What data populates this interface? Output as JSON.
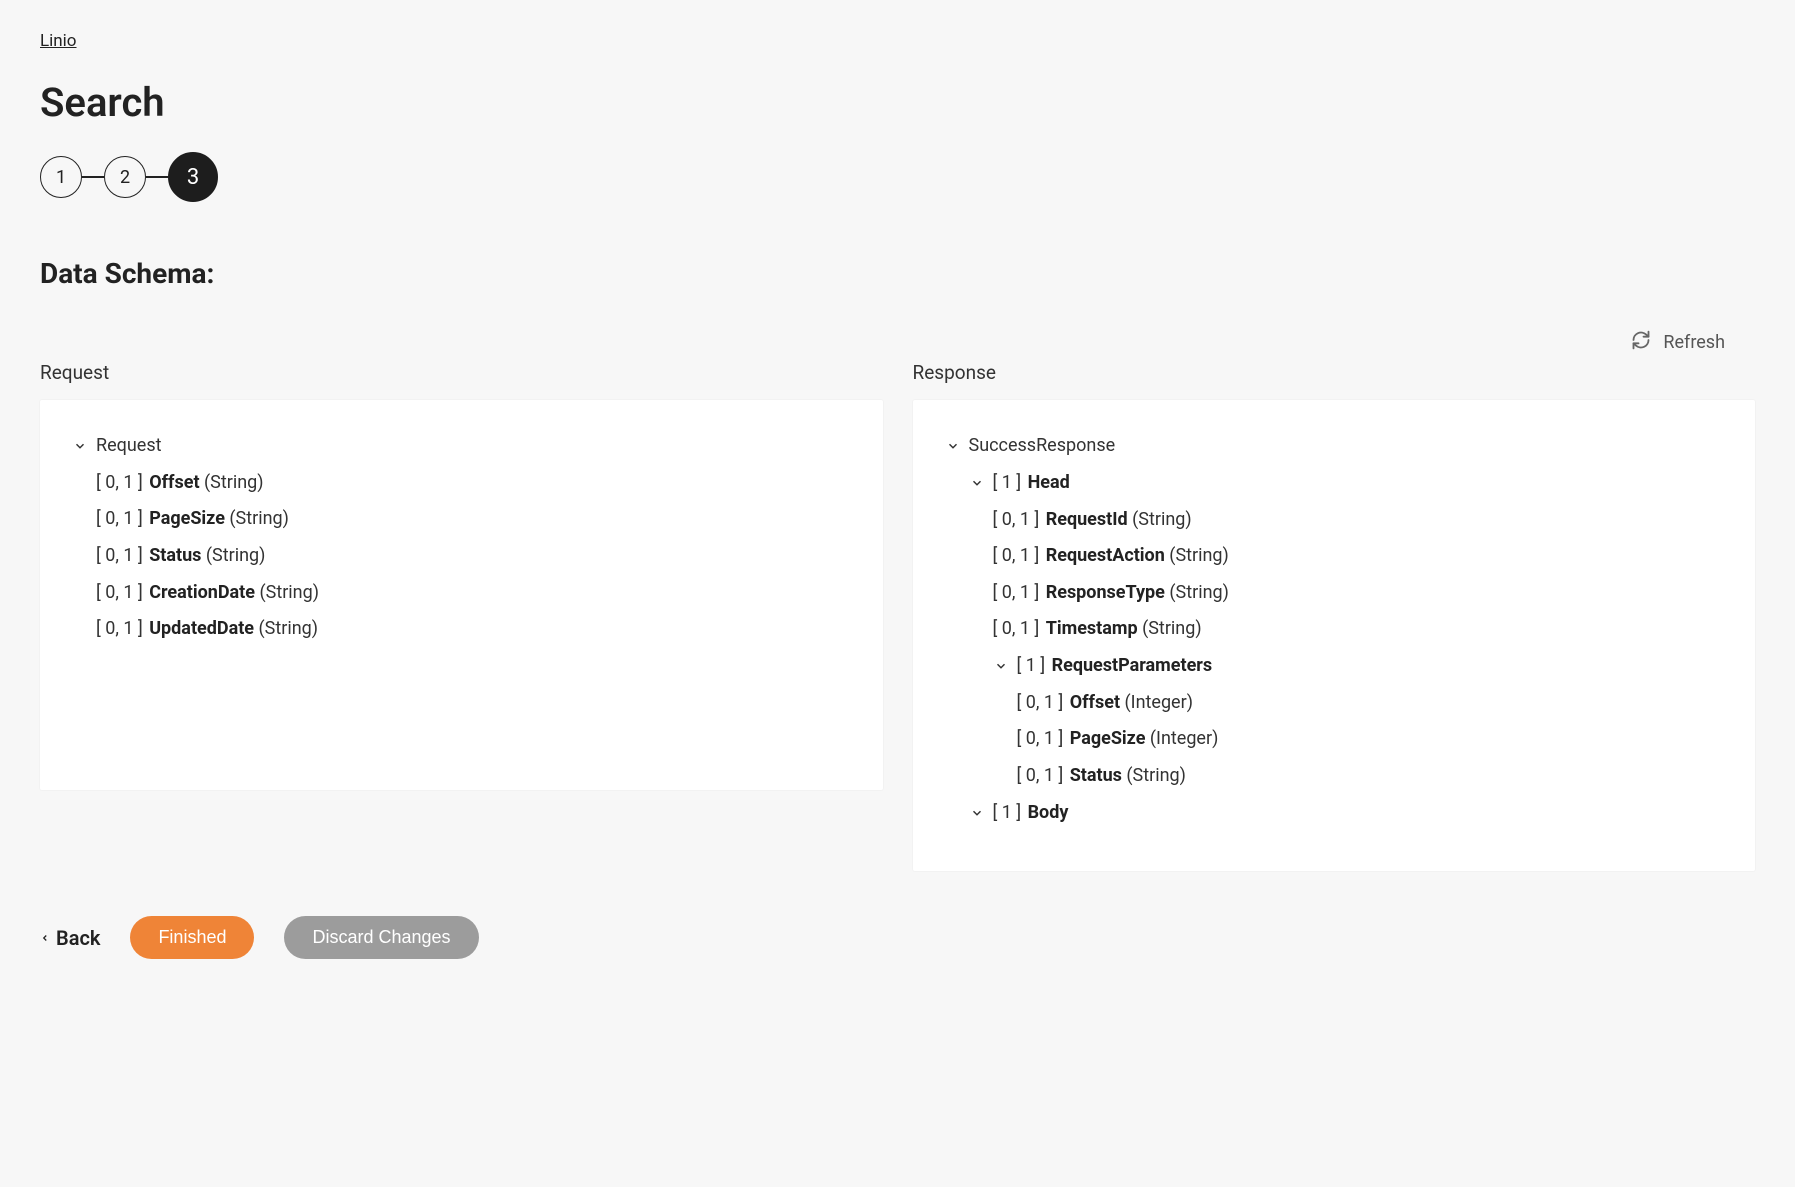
{
  "breadcrumb": "Linio",
  "page_title": "Search",
  "stepper": {
    "steps": [
      "1",
      "2",
      "3"
    ],
    "active_index": 2
  },
  "section_title": "Data Schema:",
  "refresh_label": "Refresh",
  "request_header": "Request",
  "response_header": "Response",
  "request_tree": {
    "root": "Request",
    "fields": [
      {
        "card": "[ 0, 1 ]",
        "name": "Offset",
        "type": "(String)"
      },
      {
        "card": "[ 0, 1 ]",
        "name": "PageSize",
        "type": "(String)"
      },
      {
        "card": "[ 0, 1 ]",
        "name": "Status",
        "type": "(String)"
      },
      {
        "card": "[ 0, 1 ]",
        "name": "CreationDate",
        "type": "(String)"
      },
      {
        "card": "[ 0, 1 ]",
        "name": "UpdatedDate",
        "type": "(String)"
      }
    ]
  },
  "response_tree": {
    "root": "SuccessResponse",
    "head": {
      "card": "[ 1 ]",
      "name": "Head",
      "fields": [
        {
          "card": "[ 0, 1 ]",
          "name": "RequestId",
          "type": "(String)"
        },
        {
          "card": "[ 0, 1 ]",
          "name": "RequestAction",
          "type": "(String)"
        },
        {
          "card": "[ 0, 1 ]",
          "name": "ResponseType",
          "type": "(String)"
        },
        {
          "card": "[ 0, 1 ]",
          "name": "Timestamp",
          "type": "(String)"
        }
      ],
      "request_parameters": {
        "card": "[ 1 ]",
        "name": "RequestParameters",
        "fields": [
          {
            "card": "[ 0, 1 ]",
            "name": "Offset",
            "type": "(Integer)"
          },
          {
            "card": "[ 0, 1 ]",
            "name": "PageSize",
            "type": "(Integer)"
          },
          {
            "card": "[ 0, 1 ]",
            "name": "Status",
            "type": "(String)"
          }
        ]
      }
    },
    "body": {
      "card": "[ 1 ]",
      "name": "Body"
    }
  },
  "footer": {
    "back": "Back",
    "finished": "Finished",
    "discard": "Discard Changes"
  }
}
